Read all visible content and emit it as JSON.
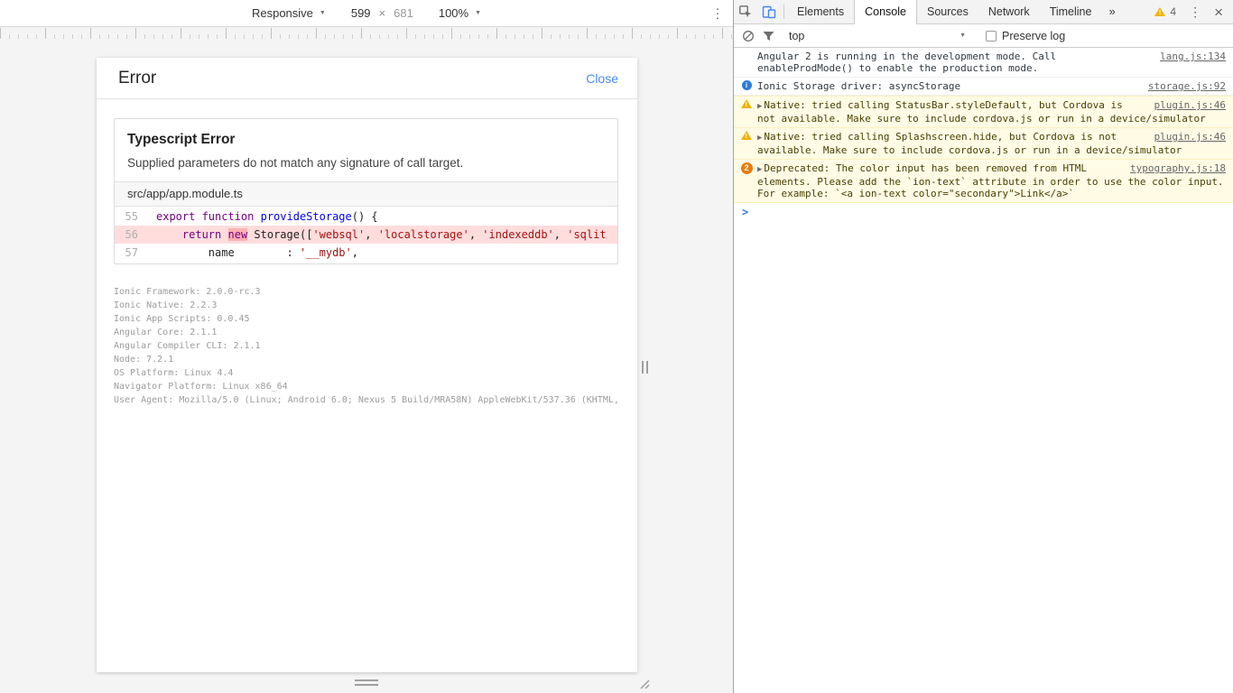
{
  "device_toolbar": {
    "mode_label": "Responsive",
    "width_value": "599",
    "dimension_separator": "×",
    "height_value": "681",
    "zoom_value": "100%"
  },
  "error_overlay": {
    "title": "Error",
    "close_label": "Close",
    "error_heading": "Typescript Error",
    "error_message": "Supplied parameters do not match any signature of call target.",
    "file_path": "src/app/app.module.ts",
    "code_lines": [
      {
        "num": "55",
        "highlight": false,
        "tokens": [
          {
            "t": "export function ",
            "c": "kw"
          },
          {
            "t": "provideStorage",
            "c": "def"
          },
          {
            "t": "() {"
          }
        ]
      },
      {
        "num": "56",
        "highlight": true,
        "tokens": [
          {
            "t": "    "
          },
          {
            "t": "return",
            "c": "kw"
          },
          {
            "t": " "
          },
          {
            "t": "new",
            "c": "kw",
            "m": true
          },
          {
            "t": " Storage(["
          },
          {
            "t": "'websql'",
            "c": "str"
          },
          {
            "t": ", "
          },
          {
            "t": "'localstorage'",
            "c": "str"
          },
          {
            "t": ", "
          },
          {
            "t": "'indexeddb'",
            "c": "str"
          },
          {
            "t": ", "
          },
          {
            "t": "'sqlit",
            "c": "str"
          }
        ]
      },
      {
        "num": "57",
        "highlight": false,
        "tokens": [
          {
            "t": "        name        : "
          },
          {
            "t": "'__mydb'",
            "c": "str"
          },
          {
            "t": ","
          }
        ]
      }
    ],
    "info_lines": [
      "Ionic Framework: 2.0.0-rc.3",
      "Ionic Native: 2.2.3",
      "Ionic App Scripts: 0.0.45",
      "Angular Core: 2.1.1",
      "Angular Compiler CLI: 2.1.1",
      "Node: 7.2.1",
      "OS Platform: Linux 4.4",
      "Navigator Platform: Linux x86_64",
      "User Agent: Mozilla/5.0 (Linux; Android 6.0; Nexus 5 Build/MRA58N) AppleWebKit/537.36 (KHTML,"
    ]
  },
  "devtools": {
    "tabs": [
      {
        "label": "Elements",
        "active": false
      },
      {
        "label": "Console",
        "active": true
      },
      {
        "label": "Sources",
        "active": false
      },
      {
        "label": "Network",
        "active": false
      },
      {
        "label": "Timeline",
        "active": false
      }
    ],
    "more_tabs_label": "»",
    "warning_count": "4",
    "console_toolbar": {
      "context_value": "top",
      "preserve_log_label": "Preserve log"
    },
    "messages": [
      {
        "type": "log",
        "text": "Angular 2 is running in the development mode. Call enableProdMode() to enable the production mode.",
        "source": "lang.js:134"
      },
      {
        "type": "info",
        "text": "Ionic Storage driver: asyncStorage",
        "source": "storage.js:92"
      },
      {
        "type": "warning",
        "expandable": true,
        "text": "Native: tried calling StatusBar.styleDefault, but Cordova is not available. Make sure to include cordova.js or run in a device/simulator",
        "source": "plugin.js:46"
      },
      {
        "type": "warning",
        "expandable": true,
        "text": "Native: tried calling Splashscreen.hide, but Cordova is not available. Make sure to include cordova.js or run in a device/simulator",
        "source": "plugin.js:46"
      },
      {
        "type": "warning",
        "expandable": true,
        "badge": "2",
        "text": "Deprecated: The color input has been removed from HTML elements. Please add the `ion-text` attribute in order to use the color input. For example: `<a ion-text color=\"secondary\">Link</a>`",
        "source": "typography.js:18"
      }
    ]
  },
  "colors": {
    "accent_blue": "#488aff",
    "device_icon_blue": "#4285f4",
    "warning_bg": "#fffbe5",
    "warning_border": "#fbf0bd",
    "highlight_line_bg": "#ffdddd",
    "error_token_bg": "#ffb0b0",
    "repeat_badge_orange": "#e87c0c"
  }
}
